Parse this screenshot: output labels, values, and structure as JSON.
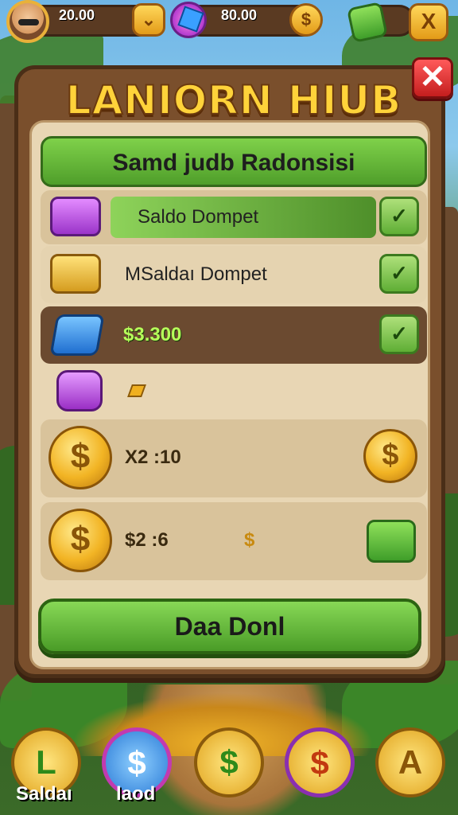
{
  "top_bar": {
    "coins_value": "20.00",
    "gems_value": "80.00",
    "coin_button_icon": "dollar-coin-icon",
    "dollar_button_icon": "dollar-coin-icon",
    "close_button_symbol": "X"
  },
  "dialog": {
    "title": "LANIORN HIUB",
    "header": "Samd judb Radonsisi",
    "close_symbol": "✕",
    "rows": [
      {
        "label": "Saldo Dompet",
        "icon": "purple-cash-stack-icon",
        "action": "✓"
      },
      {
        "label": "MSaldaı Dompet",
        "icon": "gold-cash-stack-icon",
        "action": "✓"
      },
      {
        "label": "$3.300",
        "icon": "blue-dollar-gem-icon",
        "action": "✓"
      },
      {
        "label": "",
        "icon": "purple-coin-icon",
        "marker": "small-gold-arrow-icon"
      },
      {
        "label": "X2 :10",
        "icon": "dollar-coin-icon",
        "right_icon": "dollar-coin-icon"
      },
      {
        "label": "$2 :6",
        "icon": "dollar-coin-icon",
        "right_icon": "green-gem-icon",
        "marker_text": "$"
      }
    ],
    "confirm_button": "Daa Donl"
  },
  "bottom_nav": {
    "items": [
      {
        "label": "Saldaı",
        "symbol": "L"
      },
      {
        "label": "laod",
        "symbol": "$"
      },
      {
        "label": "",
        "symbol": "$"
      },
      {
        "label": "",
        "symbol": "$"
      },
      {
        "label": "",
        "symbol": "A"
      }
    ]
  },
  "colors": {
    "accent_green": "#5fae35",
    "wood": "#7a4f2c",
    "parchment": "#e8d6b4",
    "gold": "#f2b424",
    "close_red": "#c41e1e"
  }
}
